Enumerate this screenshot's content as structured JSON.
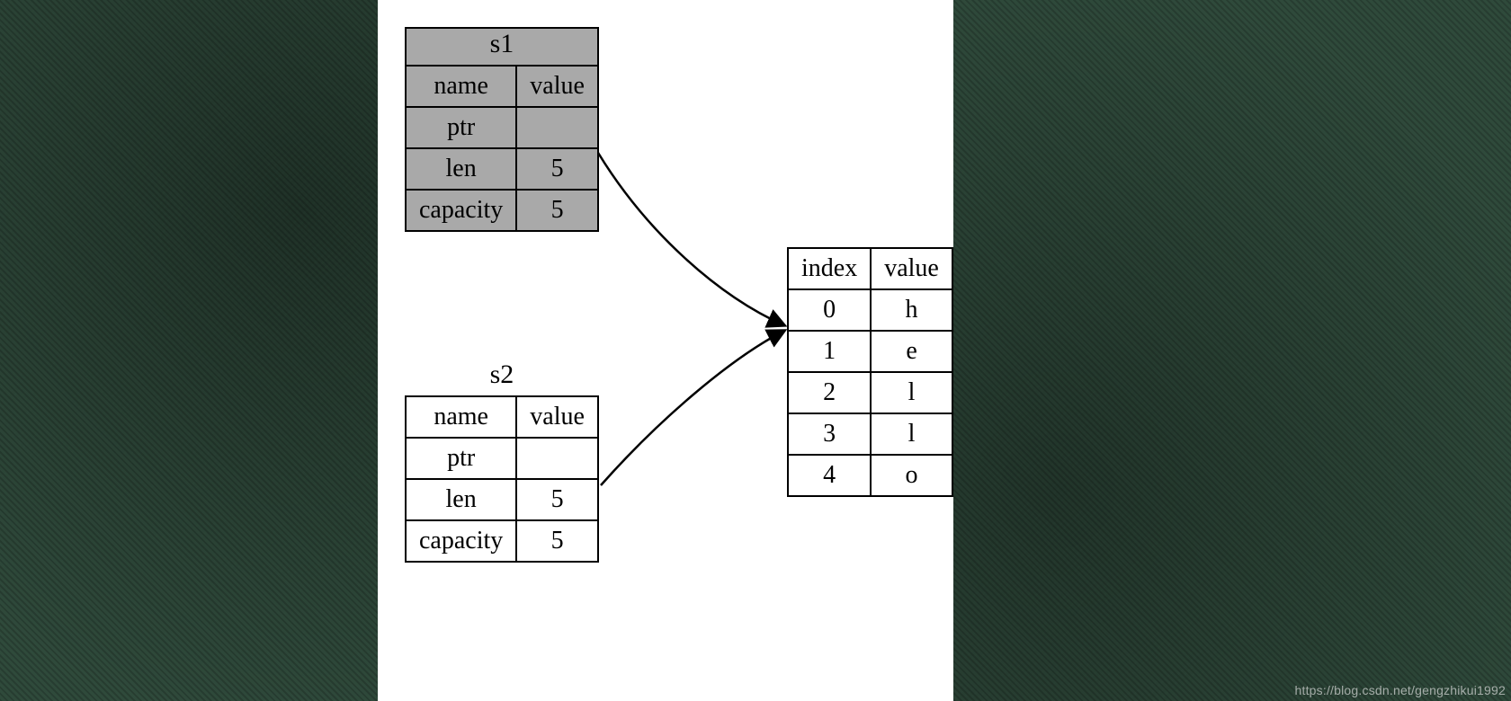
{
  "s1": {
    "title": "s1",
    "headers": {
      "name": "name",
      "value": "value"
    },
    "rows": [
      {
        "name": "ptr",
        "value": ""
      },
      {
        "name": "len",
        "value": "5"
      },
      {
        "name": "capacity",
        "value": "5"
      }
    ]
  },
  "s2": {
    "title": "s2",
    "headers": {
      "name": "name",
      "value": "value"
    },
    "rows": [
      {
        "name": "ptr",
        "value": ""
      },
      {
        "name": "len",
        "value": "5"
      },
      {
        "name": "capacity",
        "value": "5"
      }
    ]
  },
  "heap": {
    "headers": {
      "index": "index",
      "value": "value"
    },
    "rows": [
      {
        "index": "0",
        "value": "h"
      },
      {
        "index": "1",
        "value": "e"
      },
      {
        "index": "2",
        "value": "l"
      },
      {
        "index": "3",
        "value": "l"
      },
      {
        "index": "4",
        "value": "o"
      }
    ]
  },
  "watermark": "https://blog.csdn.net/gengzhikui1992"
}
